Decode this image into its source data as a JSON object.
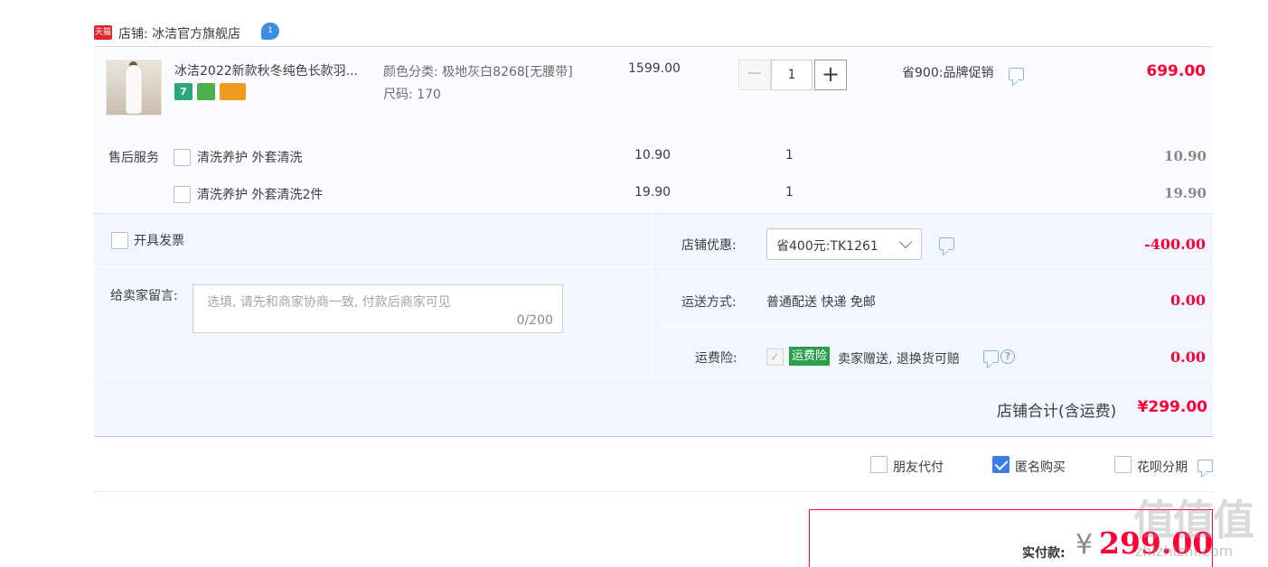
{
  "shop": {
    "platform_badge": "天猫",
    "label": "店铺: 冰洁官方旗舰店",
    "chat_badge": "1"
  },
  "item": {
    "title": "冰洁2022新款秋冬纯色长款羽...",
    "badges": [
      "7",
      "",
      ""
    ],
    "sku_color": "颜色分类: 极地灰白8268[无腰带]",
    "sku_size": "尺码: 170",
    "unit_price": "1599.00",
    "qty_minus": "−",
    "quantity": "1",
    "qty_plus": "+",
    "promotion": "省900:品牌促销",
    "total": "699.00"
  },
  "after_sale": {
    "label": "售后服务",
    "services": [
      {
        "name": "清洗养护 外套清洗",
        "price": "10.90",
        "qty": "1",
        "total": "10.90"
      },
      {
        "name": "清洗养护 外套清洗2件",
        "price": "19.90",
        "qty": "1",
        "total": "19.90"
      }
    ]
  },
  "invoice": {
    "label": "开具发票"
  },
  "message": {
    "label": "给卖家留言:",
    "placeholder": "选填, 请先和商家协商一致, 付款后商家可见",
    "counter": "0/200"
  },
  "coupon": {
    "label": "店铺优惠:",
    "selected": "省400元:TK1261",
    "amount": "-400.00"
  },
  "shipping": {
    "label": "运送方式:",
    "value": "普通配送 快递 免邮",
    "amount": "0.00"
  },
  "insurance": {
    "label": "运费险:",
    "tag": "运费险",
    "desc": "卖家赠送, 退换货可赔",
    "amount": "0.00"
  },
  "subtotal": {
    "label": "店铺合计(含运费)",
    "amount": "¥299.00"
  },
  "pay_options": [
    {
      "label": "朋友代付",
      "checked": false
    },
    {
      "label": "匿名购买",
      "checked": true
    },
    {
      "label": "花呗分期",
      "checked": false
    }
  ],
  "payment": {
    "label": "实付款:",
    "currency": "¥",
    "amount": "299.00"
  },
  "watermark": {
    "big": "值值值",
    "small": "zhizhizhi.com"
  },
  "colors": {
    "price_red": "#ff0036",
    "options_bg": "#f2f7ff",
    "checkbox_blue": "#3b7fe6",
    "insurance_green": "#2b9e4a"
  }
}
